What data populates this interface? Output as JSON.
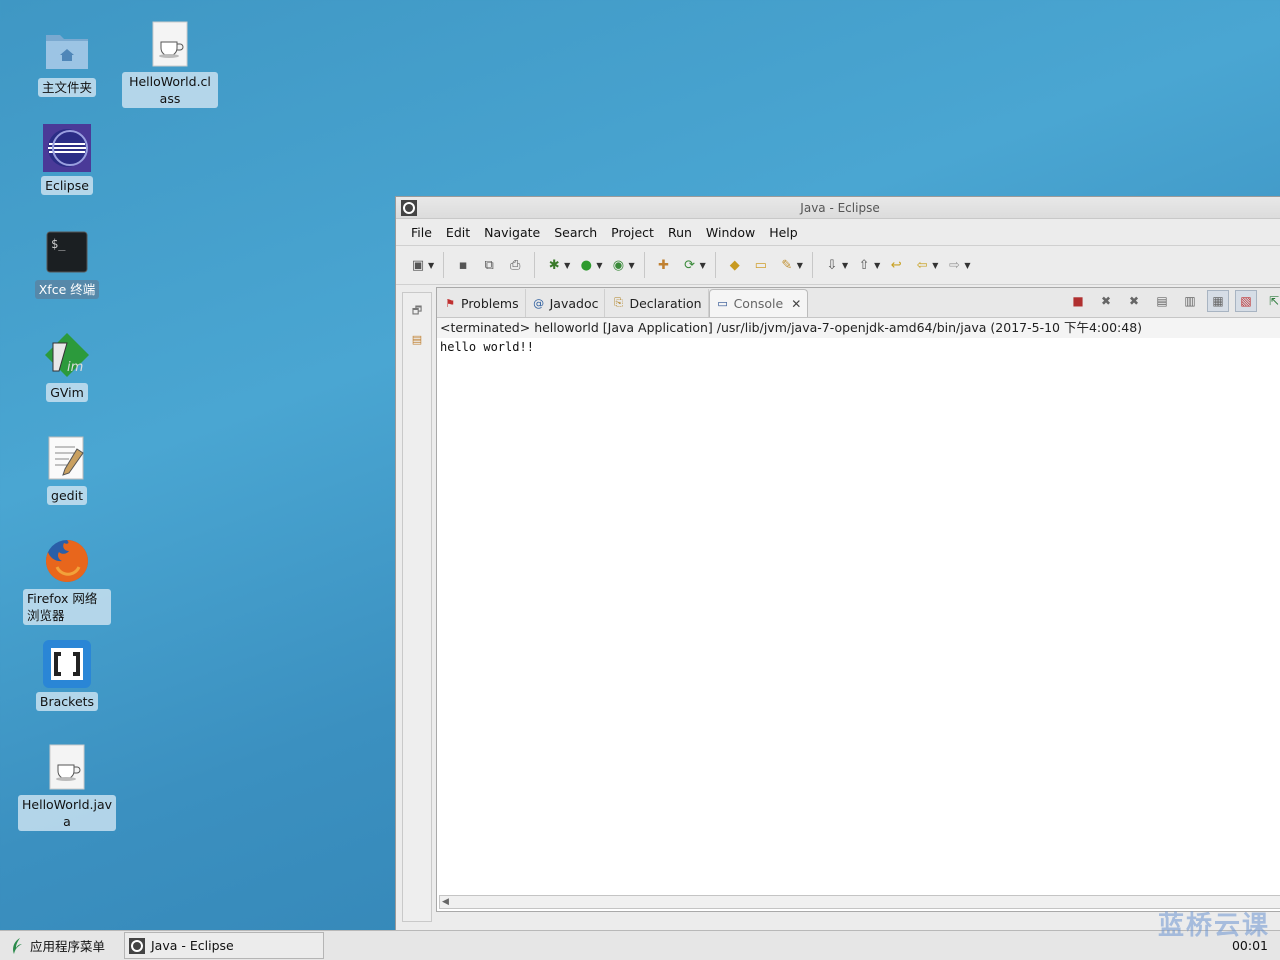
{
  "desktop": {
    "icons": [
      {
        "label": "主文件夹"
      },
      {
        "label": "HelloWorld.class"
      },
      {
        "label": "Eclipse"
      },
      {
        "label": "Xfce 终端"
      },
      {
        "label": "GVim"
      },
      {
        "label": "gedit"
      },
      {
        "label": "Firefox 网络浏览器"
      },
      {
        "label": "Brackets"
      },
      {
        "label": "HelloWorld.java"
      }
    ]
  },
  "window": {
    "title": "Java - Eclipse",
    "menu": [
      "File",
      "Edit",
      "Navigate",
      "Search",
      "Project",
      "Run",
      "Window",
      "Help"
    ],
    "tabs": [
      {
        "label": "Problems",
        "icon": "problems-icon"
      },
      {
        "label": "Javadoc",
        "icon": "at-icon"
      },
      {
        "label": "Declaration",
        "icon": "declaration-icon"
      },
      {
        "label": "Console",
        "icon": "console-icon",
        "active": true
      }
    ],
    "console": {
      "status": "<terminated> helloworld [Java Application] /usr/lib/jvm/java-7-openjdk-amd64/bin/java (2017-5-10 下午4:00:48)",
      "output": "hello world!!"
    }
  },
  "taskbar": {
    "app_menu": "应用程序菜单",
    "task": "Java - Eclipse",
    "clock": "00:01"
  },
  "watermark": "蓝桥云课"
}
